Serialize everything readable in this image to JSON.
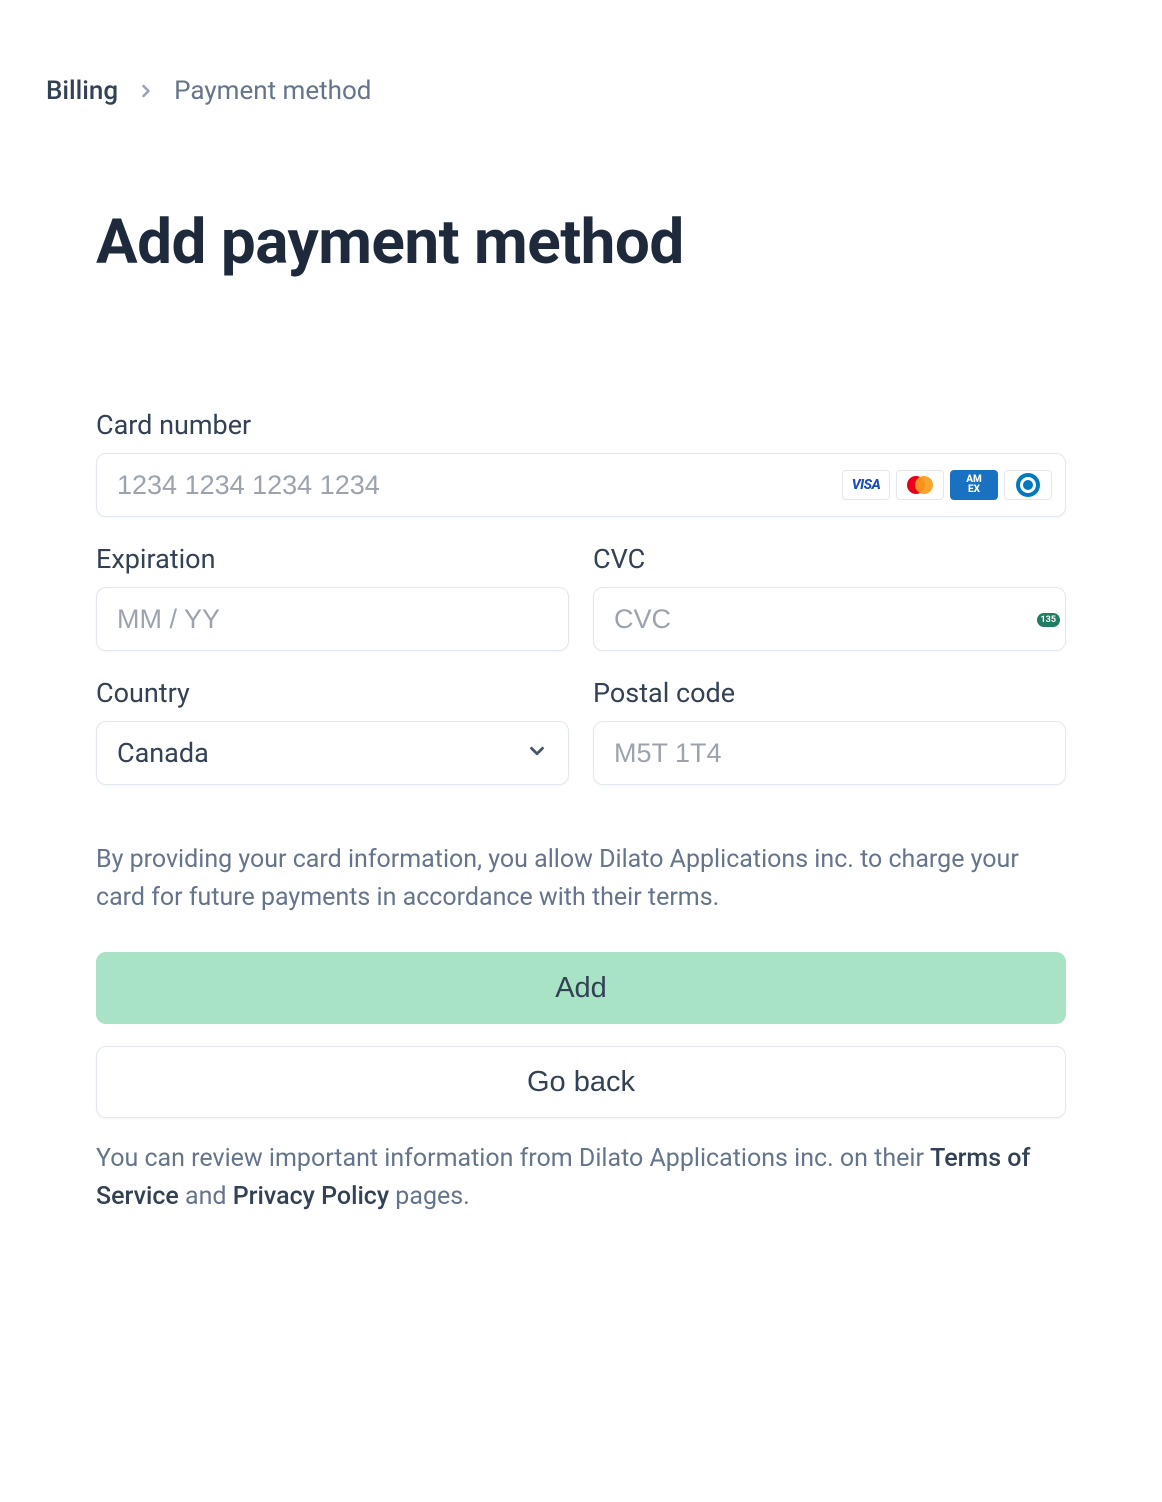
{
  "breadcrumb": {
    "parent": "Billing",
    "current": "Payment method"
  },
  "title": "Add payment method",
  "fields": {
    "card_number": {
      "label": "Card number",
      "placeholder": "1234 1234 1234 1234",
      "value": ""
    },
    "expiration": {
      "label": "Expiration",
      "placeholder": "MM / YY",
      "value": ""
    },
    "cvc": {
      "label": "CVC",
      "placeholder": "CVC",
      "value": "",
      "badge": "135"
    },
    "country": {
      "label": "Country",
      "selected": "Canada"
    },
    "postal": {
      "label": "Postal code",
      "placeholder": "M5T 1T4",
      "value": ""
    }
  },
  "card_brands": {
    "visa": "VISA",
    "amex_line1": "AM",
    "amex_line2": "EX"
  },
  "disclosure": "By providing your card information, you allow Dilato Applications inc. to charge your card for future payments in accordance with their terms.",
  "buttons": {
    "add": "Add",
    "back": "Go back"
  },
  "footer": {
    "prefix": "You can review important information from Dilato Applications inc. on their ",
    "tos": "Terms of Service",
    "mid": " and ",
    "privacy": "Privacy Policy",
    "suffix": " pages."
  }
}
